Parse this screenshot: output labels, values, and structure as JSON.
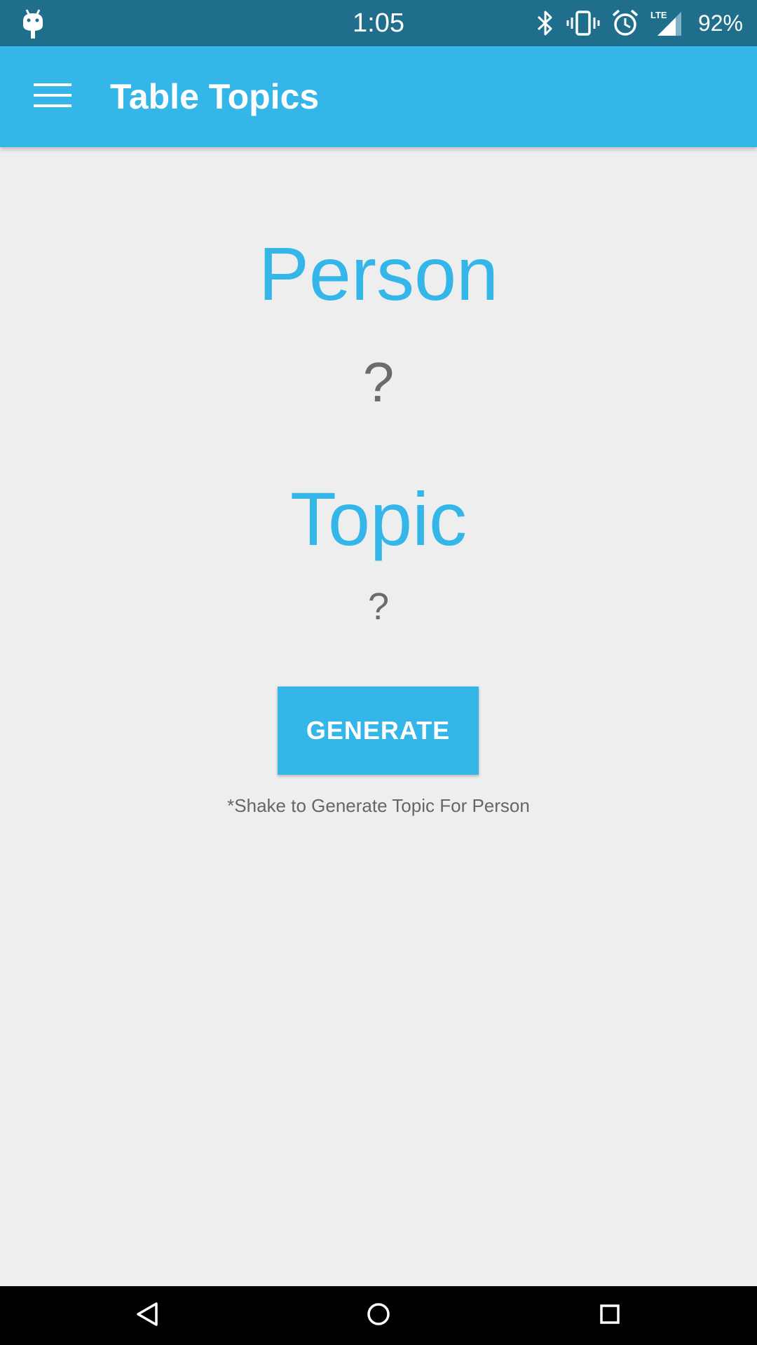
{
  "status_bar": {
    "time": "1:05",
    "battery_percent": "92%",
    "network_label": "LTE",
    "icons": [
      "android-debug-icon",
      "bluetooth-icon",
      "vibrate-icon",
      "alarm-icon",
      "signal-icon"
    ]
  },
  "app_bar": {
    "title": "Table Topics",
    "menu_icon": "hamburger-menu-icon",
    "color": "#35b6e8"
  },
  "main": {
    "person_heading": "Person",
    "person_value": "?",
    "topic_heading": "Topic",
    "topic_value": "?",
    "generate_label": "GENERATE",
    "hint": "*Shake to Generate Topic For Person",
    "accent_color": "#35b6e8"
  },
  "nav_bar": {
    "icons": [
      "back-icon",
      "home-icon",
      "recents-icon"
    ]
  }
}
